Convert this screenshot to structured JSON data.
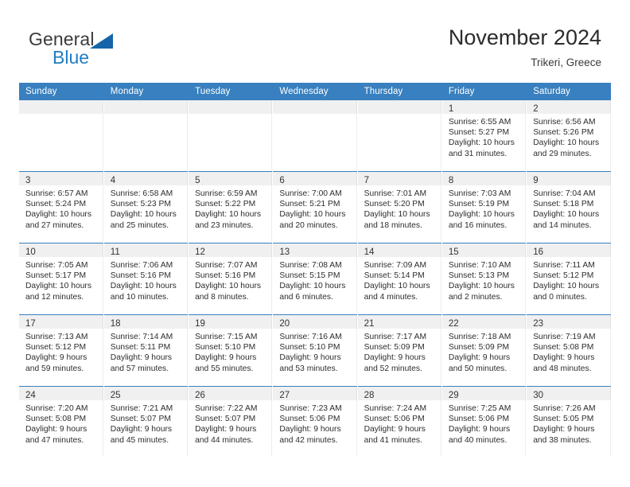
{
  "brand": {
    "name_top": "General",
    "name_bottom": "Blue",
    "triangle_icon": "triangle-icon",
    "color_dark": "#3b3b3b",
    "color_blue": "#1f7ec4"
  },
  "header": {
    "title": "November 2024",
    "subtitle": "Trikeri, Greece"
  },
  "colors": {
    "header_blue": "#3880bf",
    "daynum_band": "#f0f0f0",
    "text": "#2d2d2d"
  },
  "calendar": {
    "weekday_headers": [
      "Sunday",
      "Monday",
      "Tuesday",
      "Wednesday",
      "Thursday",
      "Friday",
      "Saturday"
    ],
    "weeks": [
      [
        {
          "blank": true
        },
        {
          "blank": true
        },
        {
          "blank": true
        },
        {
          "blank": true
        },
        {
          "blank": true
        },
        {
          "day": "1",
          "sunrise": "Sunrise: 6:55 AM",
          "sunset": "Sunset: 5:27 PM",
          "daylight_1": "Daylight: 10 hours",
          "daylight_2": "and 31 minutes."
        },
        {
          "day": "2",
          "sunrise": "Sunrise: 6:56 AM",
          "sunset": "Sunset: 5:26 PM",
          "daylight_1": "Daylight: 10 hours",
          "daylight_2": "and 29 minutes."
        }
      ],
      [
        {
          "day": "3",
          "sunrise": "Sunrise: 6:57 AM",
          "sunset": "Sunset: 5:24 PM",
          "daylight_1": "Daylight: 10 hours",
          "daylight_2": "and 27 minutes."
        },
        {
          "day": "4",
          "sunrise": "Sunrise: 6:58 AM",
          "sunset": "Sunset: 5:23 PM",
          "daylight_1": "Daylight: 10 hours",
          "daylight_2": "and 25 minutes."
        },
        {
          "day": "5",
          "sunrise": "Sunrise: 6:59 AM",
          "sunset": "Sunset: 5:22 PM",
          "daylight_1": "Daylight: 10 hours",
          "daylight_2": "and 23 minutes."
        },
        {
          "day": "6",
          "sunrise": "Sunrise: 7:00 AM",
          "sunset": "Sunset: 5:21 PM",
          "daylight_1": "Daylight: 10 hours",
          "daylight_2": "and 20 minutes."
        },
        {
          "day": "7",
          "sunrise": "Sunrise: 7:01 AM",
          "sunset": "Sunset: 5:20 PM",
          "daylight_1": "Daylight: 10 hours",
          "daylight_2": "and 18 minutes."
        },
        {
          "day": "8",
          "sunrise": "Sunrise: 7:03 AM",
          "sunset": "Sunset: 5:19 PM",
          "daylight_1": "Daylight: 10 hours",
          "daylight_2": "and 16 minutes."
        },
        {
          "day": "9",
          "sunrise": "Sunrise: 7:04 AM",
          "sunset": "Sunset: 5:18 PM",
          "daylight_1": "Daylight: 10 hours",
          "daylight_2": "and 14 minutes."
        }
      ],
      [
        {
          "day": "10",
          "sunrise": "Sunrise: 7:05 AM",
          "sunset": "Sunset: 5:17 PM",
          "daylight_1": "Daylight: 10 hours",
          "daylight_2": "and 12 minutes."
        },
        {
          "day": "11",
          "sunrise": "Sunrise: 7:06 AM",
          "sunset": "Sunset: 5:16 PM",
          "daylight_1": "Daylight: 10 hours",
          "daylight_2": "and 10 minutes."
        },
        {
          "day": "12",
          "sunrise": "Sunrise: 7:07 AM",
          "sunset": "Sunset: 5:16 PM",
          "daylight_1": "Daylight: 10 hours",
          "daylight_2": "and 8 minutes."
        },
        {
          "day": "13",
          "sunrise": "Sunrise: 7:08 AM",
          "sunset": "Sunset: 5:15 PM",
          "daylight_1": "Daylight: 10 hours",
          "daylight_2": "and 6 minutes."
        },
        {
          "day": "14",
          "sunrise": "Sunrise: 7:09 AM",
          "sunset": "Sunset: 5:14 PM",
          "daylight_1": "Daylight: 10 hours",
          "daylight_2": "and 4 minutes."
        },
        {
          "day": "15",
          "sunrise": "Sunrise: 7:10 AM",
          "sunset": "Sunset: 5:13 PM",
          "daylight_1": "Daylight: 10 hours",
          "daylight_2": "and 2 minutes."
        },
        {
          "day": "16",
          "sunrise": "Sunrise: 7:11 AM",
          "sunset": "Sunset: 5:12 PM",
          "daylight_1": "Daylight: 10 hours",
          "daylight_2": "and 0 minutes."
        }
      ],
      [
        {
          "day": "17",
          "sunrise": "Sunrise: 7:13 AM",
          "sunset": "Sunset: 5:12 PM",
          "daylight_1": "Daylight: 9 hours",
          "daylight_2": "and 59 minutes."
        },
        {
          "day": "18",
          "sunrise": "Sunrise: 7:14 AM",
          "sunset": "Sunset: 5:11 PM",
          "daylight_1": "Daylight: 9 hours",
          "daylight_2": "and 57 minutes."
        },
        {
          "day": "19",
          "sunrise": "Sunrise: 7:15 AM",
          "sunset": "Sunset: 5:10 PM",
          "daylight_1": "Daylight: 9 hours",
          "daylight_2": "and 55 minutes."
        },
        {
          "day": "20",
          "sunrise": "Sunrise: 7:16 AM",
          "sunset": "Sunset: 5:10 PM",
          "daylight_1": "Daylight: 9 hours",
          "daylight_2": "and 53 minutes."
        },
        {
          "day": "21",
          "sunrise": "Sunrise: 7:17 AM",
          "sunset": "Sunset: 5:09 PM",
          "daylight_1": "Daylight: 9 hours",
          "daylight_2": "and 52 minutes."
        },
        {
          "day": "22",
          "sunrise": "Sunrise: 7:18 AM",
          "sunset": "Sunset: 5:09 PM",
          "daylight_1": "Daylight: 9 hours",
          "daylight_2": "and 50 minutes."
        },
        {
          "day": "23",
          "sunrise": "Sunrise: 7:19 AM",
          "sunset": "Sunset: 5:08 PM",
          "daylight_1": "Daylight: 9 hours",
          "daylight_2": "and 48 minutes."
        }
      ],
      [
        {
          "day": "24",
          "sunrise": "Sunrise: 7:20 AM",
          "sunset": "Sunset: 5:08 PM",
          "daylight_1": "Daylight: 9 hours",
          "daylight_2": "and 47 minutes."
        },
        {
          "day": "25",
          "sunrise": "Sunrise: 7:21 AM",
          "sunset": "Sunset: 5:07 PM",
          "daylight_1": "Daylight: 9 hours",
          "daylight_2": "and 45 minutes."
        },
        {
          "day": "26",
          "sunrise": "Sunrise: 7:22 AM",
          "sunset": "Sunset: 5:07 PM",
          "daylight_1": "Daylight: 9 hours",
          "daylight_2": "and 44 minutes."
        },
        {
          "day": "27",
          "sunrise": "Sunrise: 7:23 AM",
          "sunset": "Sunset: 5:06 PM",
          "daylight_1": "Daylight: 9 hours",
          "daylight_2": "and 42 minutes."
        },
        {
          "day": "28",
          "sunrise": "Sunrise: 7:24 AM",
          "sunset": "Sunset: 5:06 PM",
          "daylight_1": "Daylight: 9 hours",
          "daylight_2": "and 41 minutes."
        },
        {
          "day": "29",
          "sunrise": "Sunrise: 7:25 AM",
          "sunset": "Sunset: 5:06 PM",
          "daylight_1": "Daylight: 9 hours",
          "daylight_2": "and 40 minutes."
        },
        {
          "day": "30",
          "sunrise": "Sunrise: 7:26 AM",
          "sunset": "Sunset: 5:05 PM",
          "daylight_1": "Daylight: 9 hours",
          "daylight_2": "and 38 minutes."
        }
      ]
    ]
  }
}
